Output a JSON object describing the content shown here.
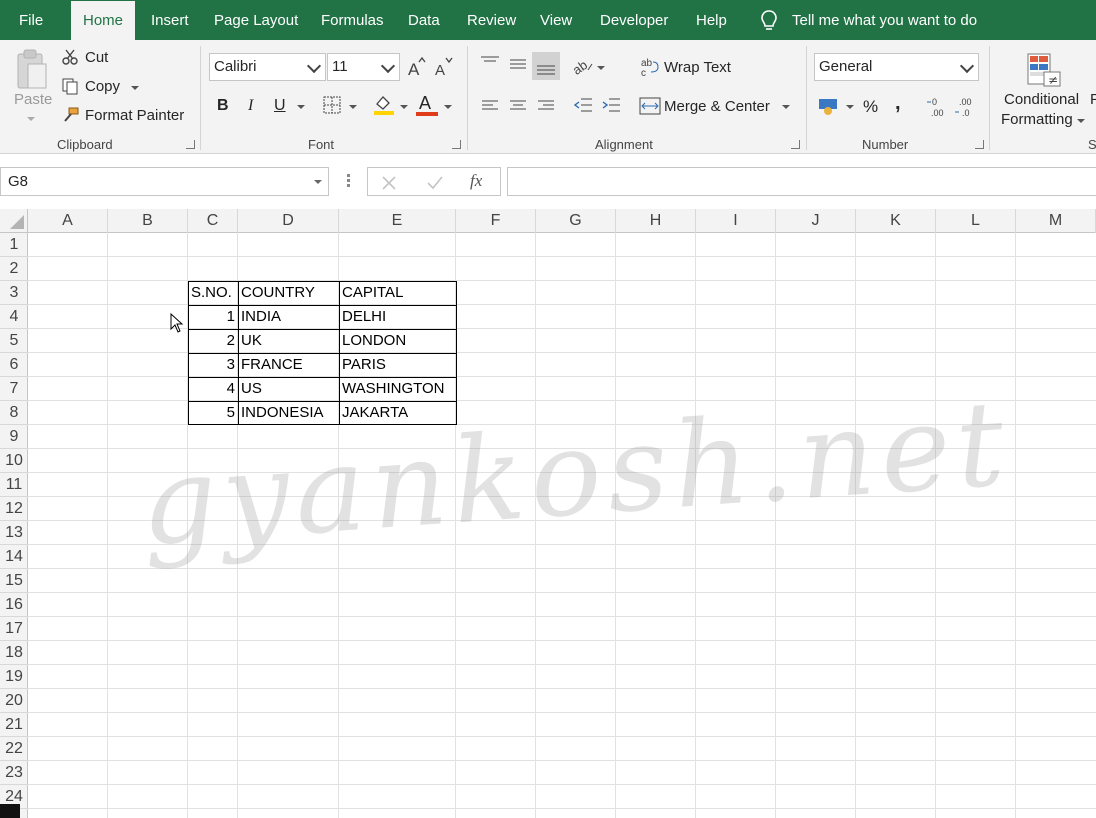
{
  "ribbon_tabs": [
    "File",
    "Home",
    "Insert",
    "Page Layout",
    "Formulas",
    "Data",
    "Review",
    "View",
    "Developer",
    "Help"
  ],
  "tell_me": "Tell me what you want to do",
  "clipboard": {
    "paste": "Paste",
    "cut": "Cut",
    "copy": "Copy",
    "format_painter": "Format Painter",
    "group": "Clipboard"
  },
  "font": {
    "name": "Calibri",
    "size": "11",
    "group": "Font",
    "bold": "B",
    "italic": "I",
    "underline": "U",
    "font_color_letter": "A"
  },
  "alignment": {
    "wrap_text": "Wrap Text",
    "merge_center": "Merge & Center",
    "group": "Alignment"
  },
  "number": {
    "format": "General",
    "group": "Number",
    "percent": "%",
    "comma": ","
  },
  "styles": {
    "conditional_line1": "Conditional",
    "conditional_line2": "Formatting",
    "partial_label": "F",
    "group_partial": "St"
  },
  "formula_bar": {
    "name_box": "G8",
    "formula": "",
    "fx": "fx"
  },
  "columns": [
    "A",
    "B",
    "C",
    "D",
    "E",
    "F",
    "G",
    "H",
    "I",
    "J",
    "K",
    "L",
    "M"
  ],
  "rows": [
    "1",
    "2",
    "3",
    "4",
    "5",
    "6",
    "7",
    "8",
    "9",
    "10",
    "11",
    "12",
    "13",
    "14",
    "15",
    "16",
    "17",
    "18",
    "19",
    "20",
    "21",
    "22",
    "23",
    "24"
  ],
  "table": {
    "headers": [
      "S.NO.",
      "COUNTRY",
      "CAPITAL"
    ],
    "rows": [
      [
        "1",
        "INDIA",
        "DELHI"
      ],
      [
        "2",
        "UK",
        "LONDON"
      ],
      [
        "3",
        "FRANCE",
        "PARIS"
      ],
      [
        "4",
        "US",
        "WASHINGTON"
      ],
      [
        "5",
        "INDONESIA",
        "JAKARTA"
      ]
    ]
  },
  "watermark": "gyankosh.net",
  "colors": {
    "ribbon_green": "#217346",
    "font_highlight": "#ffd400",
    "font_color": "#e03c1c"
  }
}
